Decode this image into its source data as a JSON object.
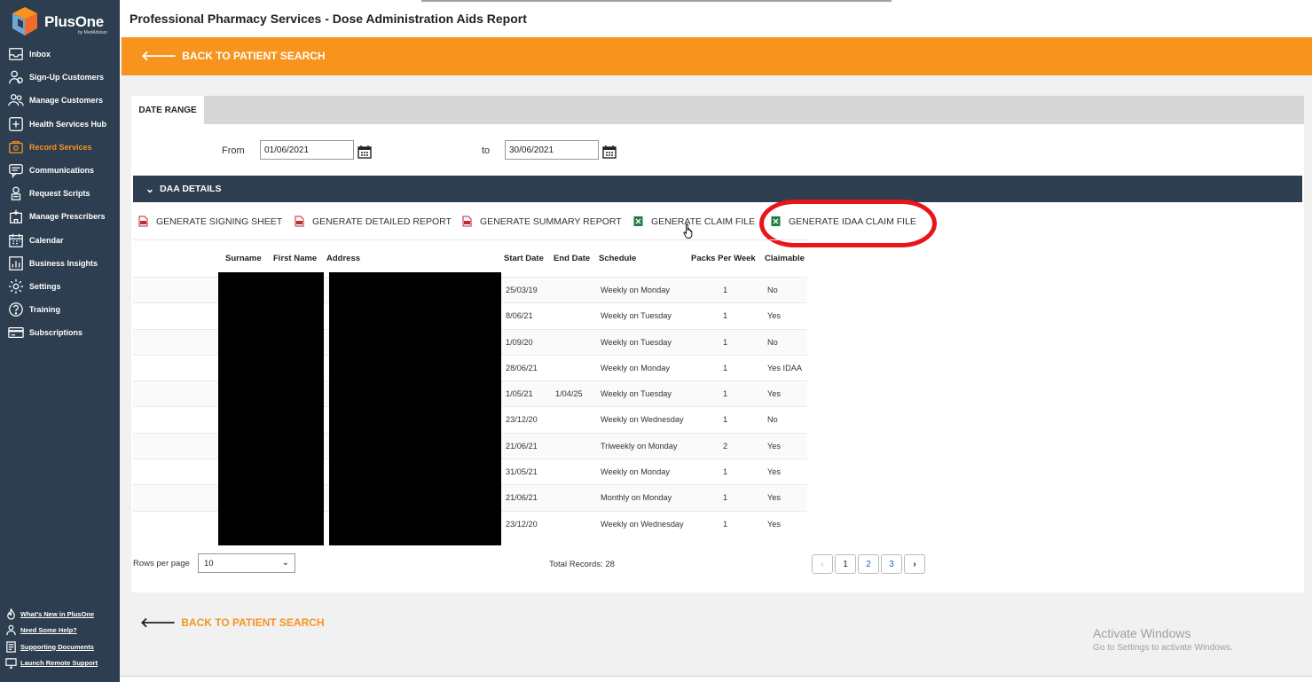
{
  "app": {
    "brand": "PlusOne",
    "brand_sub": "by MedAdvisor"
  },
  "sidebar": {
    "items": [
      {
        "label": "Inbox",
        "icon": "inbox-icon"
      },
      {
        "label": "Sign-Up Customers",
        "icon": "user-add-icon"
      },
      {
        "label": "Manage Customers",
        "icon": "users-icon"
      },
      {
        "label": "Health Services Hub",
        "icon": "medical-cross-icon"
      },
      {
        "label": "Record Services",
        "icon": "box-icon",
        "active": true
      },
      {
        "label": "Communications",
        "icon": "chat-icon"
      },
      {
        "label": "Request Scripts",
        "icon": "user-doc-icon"
      },
      {
        "label": "Manage Prescribers",
        "icon": "hospital-icon"
      },
      {
        "label": "Calendar",
        "icon": "calendar-icon"
      },
      {
        "label": "Business Insights",
        "icon": "bar-chart-icon"
      },
      {
        "label": "Settings",
        "icon": "gear-icon"
      },
      {
        "label": "Training",
        "icon": "question-icon"
      },
      {
        "label": "Subscriptions",
        "icon": "card-icon"
      }
    ],
    "help_links": [
      {
        "label": "What's New in PlusOne",
        "icon": "flame-icon"
      },
      {
        "label": "Need Some Help?",
        "icon": "person-icon"
      },
      {
        "label": "Supporting Documents",
        "icon": "document-icon"
      },
      {
        "label": "Launch Remote Support",
        "icon": "monitor-icon"
      }
    ]
  },
  "header": {
    "title": "Professional Pharmacy Services - Dose Administration Aids Report",
    "back_label": "BACK TO PATIENT SEARCH"
  },
  "date_range": {
    "tab_label": "DATE RANGE",
    "from_label": "From",
    "from_value": "01/06/2021",
    "to_label": "to",
    "to_value": "30/06/2021"
  },
  "daa": {
    "section_label": "DAA DETAILS",
    "buttons": {
      "signing": "GENERATE SIGNING SHEET",
      "detailed": "GENERATE DETAILED REPORT",
      "summary": "GENERATE SUMMARY REPORT",
      "claim": "GENERATE CLAIM FILE",
      "idaa": "GENERATE IDAA CLAIM FILE"
    },
    "columns": [
      "Surname",
      "First Name",
      "Address",
      "Start Date",
      "End Date",
      "Schedule",
      "Packs Per Week",
      "Claimable"
    ],
    "rows": [
      {
        "start": "25/03/19",
        "end": "",
        "schedule": "Weekly on Monday",
        "packs": "1",
        "claimable": "No"
      },
      {
        "start": "8/06/21",
        "end": "",
        "schedule": "Weekly on Tuesday",
        "packs": "1",
        "claimable": "Yes"
      },
      {
        "start": "1/09/20",
        "end": "",
        "schedule": "Weekly on Tuesday",
        "packs": "1",
        "claimable": "No"
      },
      {
        "start": "28/06/21",
        "end": "",
        "schedule": "Weekly on Monday",
        "packs": "1",
        "claimable": "Yes IDAA"
      },
      {
        "start": "1/05/21",
        "end": "1/04/25",
        "schedule": "Weekly on Tuesday",
        "packs": "1",
        "claimable": "Yes"
      },
      {
        "start": "23/12/20",
        "end": "",
        "schedule": "Weekly on Wednesday",
        "packs": "1",
        "claimable": "No"
      },
      {
        "start": "21/06/21",
        "end": "",
        "schedule": "Triweekly on Monday",
        "packs": "2",
        "claimable": "Yes"
      },
      {
        "start": "31/05/21",
        "end": "",
        "schedule": "Weekly on Monday",
        "packs": "1",
        "claimable": "Yes"
      },
      {
        "start": "21/06/21",
        "end": "",
        "schedule": "Monthly on Monday",
        "packs": "1",
        "claimable": "Yes"
      },
      {
        "start": "23/12/20",
        "end": "",
        "schedule": "Weekly on Wednesday",
        "packs": "1",
        "claimable": "Yes"
      }
    ],
    "rows_per_page_label": "Rows per page",
    "rows_per_page_value": "10",
    "total_records": "Total Records: 28",
    "pages": [
      "1",
      "2",
      "3"
    ],
    "prev": "‹",
    "next": "›"
  },
  "watermark": {
    "line1": "Activate Windows",
    "line2": "Go to Settings to activate Windows."
  },
  "colors": {
    "accent": "#f7941d",
    "sidebar": "#2c3e50",
    "highlight": "#e8151b"
  }
}
